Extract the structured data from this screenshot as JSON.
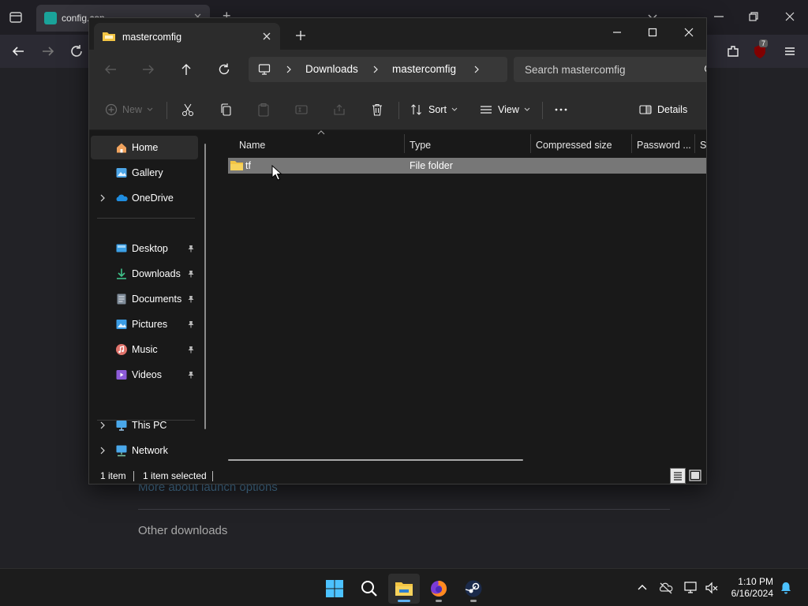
{
  "browser": {
    "tab_title": "config.con",
    "page": {
      "link": "More about launch options",
      "heading": "Other downloads"
    },
    "extension_badge": "7"
  },
  "explorer": {
    "tab_title": "mastercomfig",
    "breadcrumbs": [
      "Downloads",
      "mastercomfig"
    ],
    "search_placeholder": "Search mastercomfig",
    "toolbar": {
      "new": "New",
      "sort": "Sort",
      "view": "View",
      "details": "Details"
    },
    "sidebar": {
      "items": [
        {
          "label": "Home",
          "icon": "home-icon"
        },
        {
          "label": "Gallery",
          "icon": "gallery-icon"
        },
        {
          "label": "OneDrive",
          "icon": "onedrive-icon"
        },
        {
          "label": "Desktop",
          "icon": "desktop-icon"
        },
        {
          "label": "Downloads",
          "icon": "download-icon"
        },
        {
          "label": "Documents",
          "icon": "documents-icon"
        },
        {
          "label": "Pictures",
          "icon": "pictures-icon"
        },
        {
          "label": "Music",
          "icon": "music-icon"
        },
        {
          "label": "Videos",
          "icon": "videos-icon"
        },
        {
          "label": "This PC",
          "icon": "pc-icon"
        },
        {
          "label": "Network",
          "icon": "network-icon"
        }
      ]
    },
    "columns": [
      "Name",
      "Type",
      "Compressed size",
      "Password ...",
      "Si"
    ],
    "files": [
      {
        "name": "tf",
        "type": "File folder",
        "icon": "folder-icon"
      }
    ],
    "status": {
      "count": "1 item",
      "selected": "1 item selected"
    }
  },
  "taskbar": {
    "time": "1:10 PM",
    "date": "6/16/2024"
  },
  "colors": {
    "accent": "#5fb2f2",
    "folder": "#f3c544",
    "selection": "#777777"
  }
}
